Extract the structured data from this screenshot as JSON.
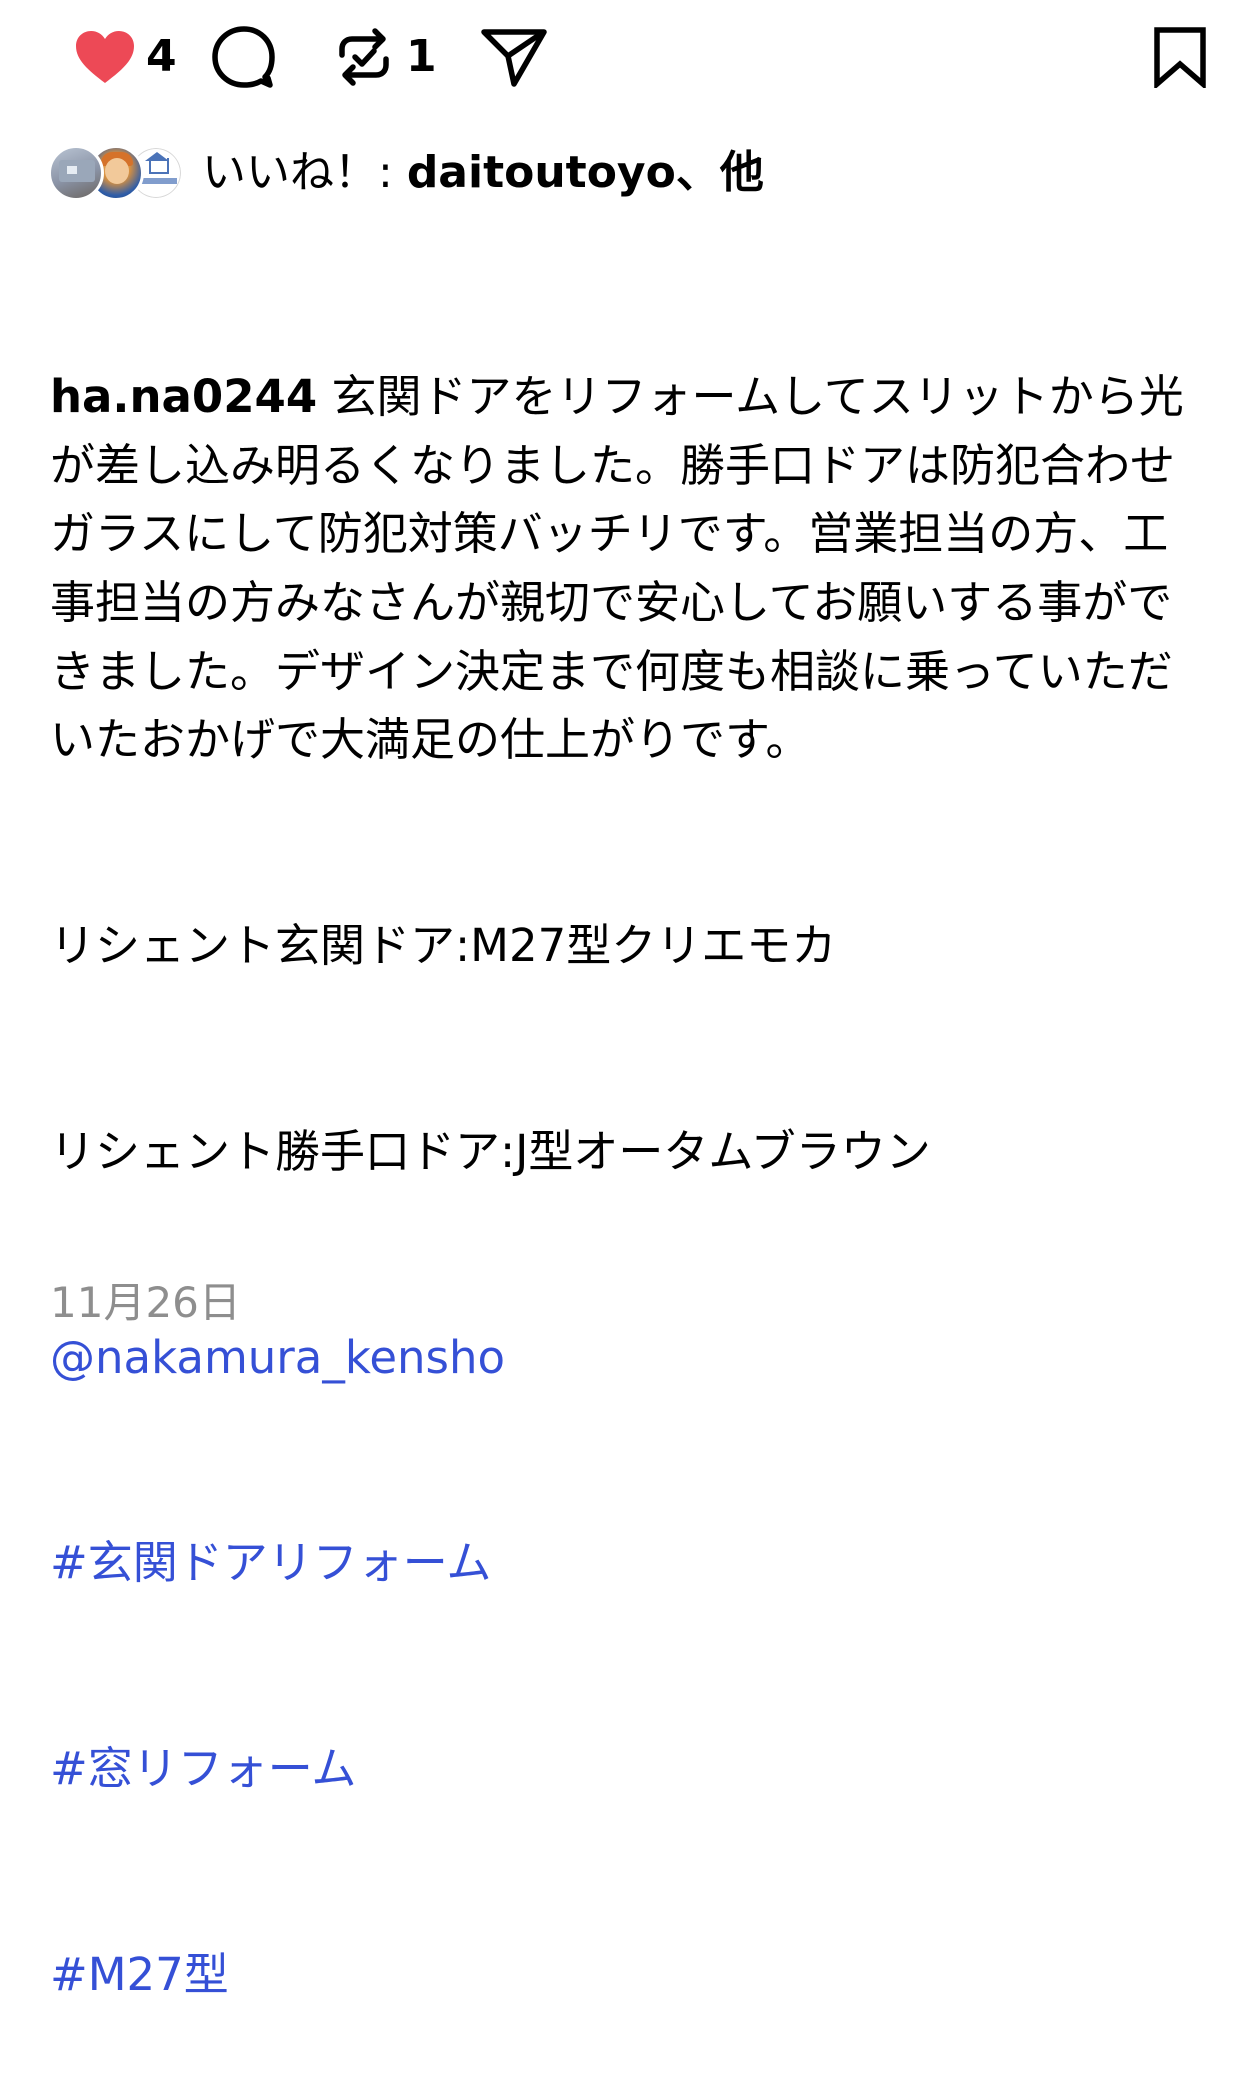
{
  "actions": {
    "like": {
      "icon": "heart-filled-icon",
      "count": "4",
      "color": "#ed4956"
    },
    "comment": {
      "icon": "comment-bubble-icon",
      "count": ""
    },
    "repost": {
      "icon": "repost-icon",
      "count": "1"
    },
    "share": {
      "icon": "paper-plane-icon",
      "count": ""
    },
    "save": {
      "icon": "bookmark-icon"
    }
  },
  "liked_by": {
    "prefix": "いいね！: ",
    "name": "daitoutoyo",
    "suffix": "、他",
    "avatars": [
      "avatar-house-photo",
      "avatar-character",
      "avatar-company-logo"
    ]
  },
  "caption": {
    "username": "ha.na0244",
    "body": " 玄関ドアをリフォームしてスリットから光が差し込み明るくなりました。勝手口ドアは防犯合わせガラスにして防犯対策バッチリです。営業担当の方、工事担当の方みなさんが親切で安心してお願いする事ができました。デザイン決定まで何度も相談に乗っていただいたおかげで大満足の仕上がりです。",
    "product_lines": [
      "リシェント玄関ドア:M27型クリエモカ",
      "リシェント勝手口ドア:J型オータムブラウン"
    ],
    "mention": "@nakamura_kensho",
    "hashtags": [
      "#玄関ドアリフォーム",
      "#窓リフォーム",
      "#M27型"
    ]
  },
  "date": "11月26日",
  "colors": {
    "link": "#3550d6",
    "date": "#8e8e8e",
    "like": "#ed4956"
  }
}
